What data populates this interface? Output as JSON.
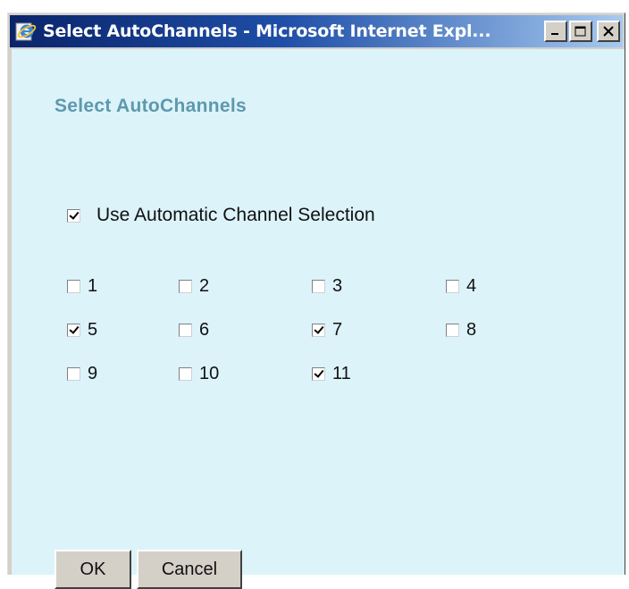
{
  "window": {
    "title": "Select AutoChannels - Microsoft Internet Expl...",
    "icon": "ie-icon"
  },
  "dialog": {
    "heading": "Select AutoChannels",
    "auto_selection": {
      "label": "Use Automatic Channel Selection",
      "checked": true
    },
    "channels": [
      {
        "label": "1",
        "checked": false
      },
      {
        "label": "2",
        "checked": false
      },
      {
        "label": "3",
        "checked": false
      },
      {
        "label": "4",
        "checked": false
      },
      {
        "label": "5",
        "checked": true
      },
      {
        "label": "6",
        "checked": false
      },
      {
        "label": "7",
        "checked": true
      },
      {
        "label": "8",
        "checked": false
      },
      {
        "label": "9",
        "checked": false
      },
      {
        "label": "10",
        "checked": false
      },
      {
        "label": "11",
        "checked": true
      }
    ],
    "buttons": {
      "ok_label": "OK",
      "cancel_label": "Cancel"
    }
  },
  "colors": {
    "content_bg": "#dcf3fa",
    "heading": "#5e98ad",
    "titlebar_start": "#0a246a",
    "titlebar_end": "#a6caf0"
  }
}
